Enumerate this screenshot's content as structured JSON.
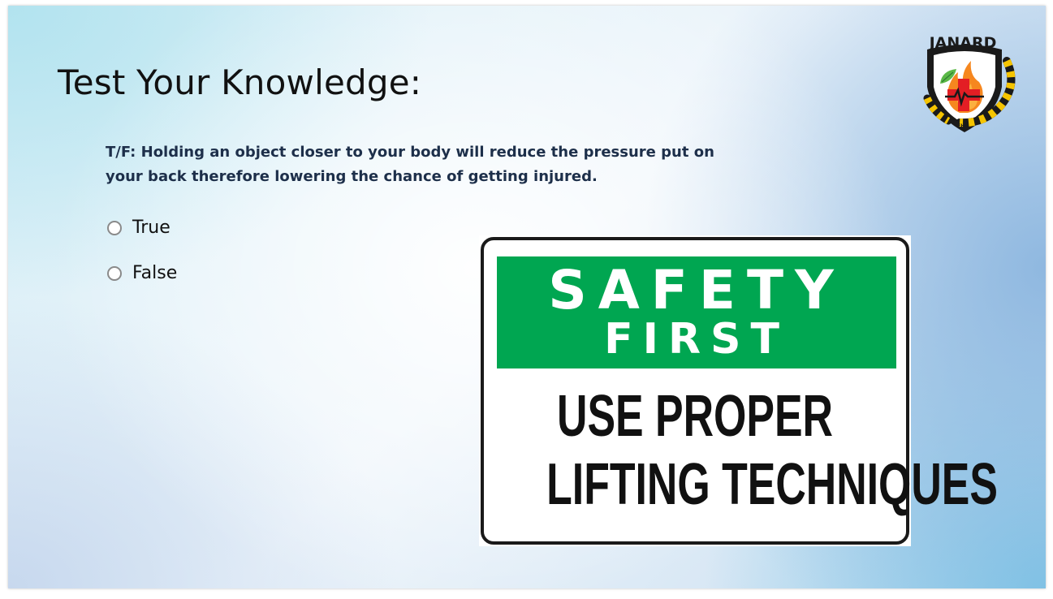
{
  "slide": {
    "title": "Test Your Knowledge:",
    "question": "T/F: Holding an object closer to your body will reduce the pressure put on your back therefore lowering the chance of getting injured.",
    "options": [
      {
        "label": "True",
        "selected": false
      },
      {
        "label": "False",
        "selected": false
      }
    ]
  },
  "sign": {
    "line1": "SAFETY",
    "line2": "FIRST",
    "body_line1": "USE PROPER",
    "body_line2": "LIFTING TECHNIQUES",
    "band_color": "#00a651"
  },
  "logo": {
    "text": "JANARD",
    "small_text": "EHS",
    "icons": [
      "shield-icon",
      "flame-icon",
      "medical-cross-icon",
      "leaf-icon"
    ]
  }
}
